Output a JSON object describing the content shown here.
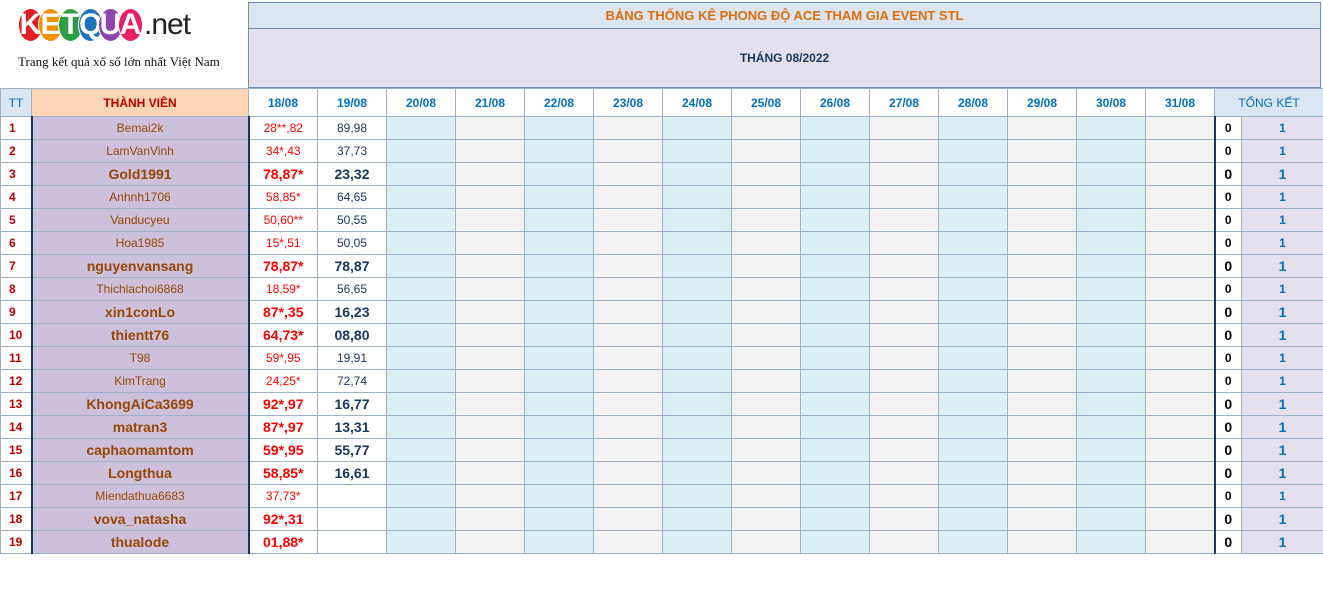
{
  "logo": {
    "letters": [
      "K",
      "E",
      "T",
      "Q",
      "U",
      "A"
    ],
    "letter_colors": [
      "#e31b23",
      "#f39200",
      "#2e9e44",
      "#1e73be",
      "#8e44ad",
      "#e91e63"
    ],
    "suffix": ".net",
    "tagline": "Trang kết quả xổ số lớn nhất Việt Nam"
  },
  "header": {
    "title": "BẢNG THỐNG KÊ PHONG ĐỘ ACE THAM GIA EVENT STL",
    "month": "THÁNG 08/2022"
  },
  "columns": {
    "tt": "TT",
    "member": "THÀNH VIÊN",
    "dates": [
      "18/08",
      "19/08",
      "20/08",
      "21/08",
      "22/08",
      "23/08",
      "24/08",
      "25/08",
      "26/08",
      "27/08",
      "28/08",
      "29/08",
      "30/08",
      "31/08"
    ],
    "total": "TỔNG KẾT"
  },
  "rows": [
    {
      "tt": "1",
      "name": "Bemai2k",
      "d18": "28**,82",
      "d19": "89,98",
      "zero": "0",
      "one": "1",
      "bold": false
    },
    {
      "tt": "2",
      "name": "LamVanVinh",
      "d18": "34*,43",
      "d19": "37,73",
      "zero": "0",
      "one": "1",
      "bold": false
    },
    {
      "tt": "3",
      "name": "Gold1991",
      "d18": "78,87*",
      "d19": "23,32",
      "zero": "0",
      "one": "1",
      "bold": true
    },
    {
      "tt": "4",
      "name": "Anhnh1706",
      "d18": "58,85*",
      "d19": "64,65",
      "zero": "0",
      "one": "1",
      "bold": false
    },
    {
      "tt": "5",
      "name": "Vanducyeu",
      "d18": "50,60**",
      "d19": "50,55",
      "zero": "0",
      "one": "1",
      "bold": false
    },
    {
      "tt": "6",
      "name": "Hoa1985",
      "d18": "15*,51",
      "d19": "50,05",
      "zero": "0",
      "one": "1",
      "bold": false
    },
    {
      "tt": "7",
      "name": "nguyenvansang",
      "d18": "78,87*",
      "d19": "78,87",
      "zero": "0",
      "one": "1",
      "bold": true
    },
    {
      "tt": "8",
      "name": "Thichlachoi6868",
      "d18": "18,59*",
      "d19": "56,65",
      "zero": "0",
      "one": "1",
      "bold": false
    },
    {
      "tt": "9",
      "name": "xin1conLo",
      "d18": "87*,35",
      "d19": "16,23",
      "zero": "0",
      "one": "1",
      "bold": true
    },
    {
      "tt": "10",
      "name": "thientt76",
      "d18": "64,73*",
      "d19": "08,80",
      "zero": "0",
      "one": "1",
      "bold": true
    },
    {
      "tt": "11",
      "name": "T98",
      "d18": "59*,95",
      "d19": "19,91",
      "zero": "0",
      "one": "1",
      "bold": false
    },
    {
      "tt": "12",
      "name": "KimTrang",
      "d18": "24,25*",
      "d19": "72,74",
      "zero": "0",
      "one": "1",
      "bold": false
    },
    {
      "tt": "13",
      "name": "KhongAiCa3699",
      "d18": "92*,97",
      "d19": "16,77",
      "zero": "0",
      "one": "1",
      "bold": true
    },
    {
      "tt": "14",
      "name": "matran3",
      "d18": "87*,97",
      "d19": "13,31",
      "zero": "0",
      "one": "1",
      "bold": true
    },
    {
      "tt": "15",
      "name": "caphaomamtom",
      "d18": "59*,95",
      "d19": "55,77",
      "zero": "0",
      "one": "1",
      "bold": true
    },
    {
      "tt": "16",
      "name": "Longthua",
      "d18": "58,85*",
      "d19": "16,61",
      "zero": "0",
      "one": "1",
      "bold": true
    },
    {
      "tt": "17",
      "name": "Miendathua6683",
      "d18": "37,73*",
      "d19": "",
      "zero": "0",
      "one": "1",
      "bold": false
    },
    {
      "tt": "18",
      "name": "vova_natasha",
      "d18": "92*,31",
      "d19": "",
      "zero": "0",
      "one": "1",
      "bold": true
    },
    {
      "tt": "19",
      "name": "thualode",
      "d18": "01,88*",
      "d19": "",
      "zero": "0",
      "one": "1",
      "bold": true
    }
  ]
}
